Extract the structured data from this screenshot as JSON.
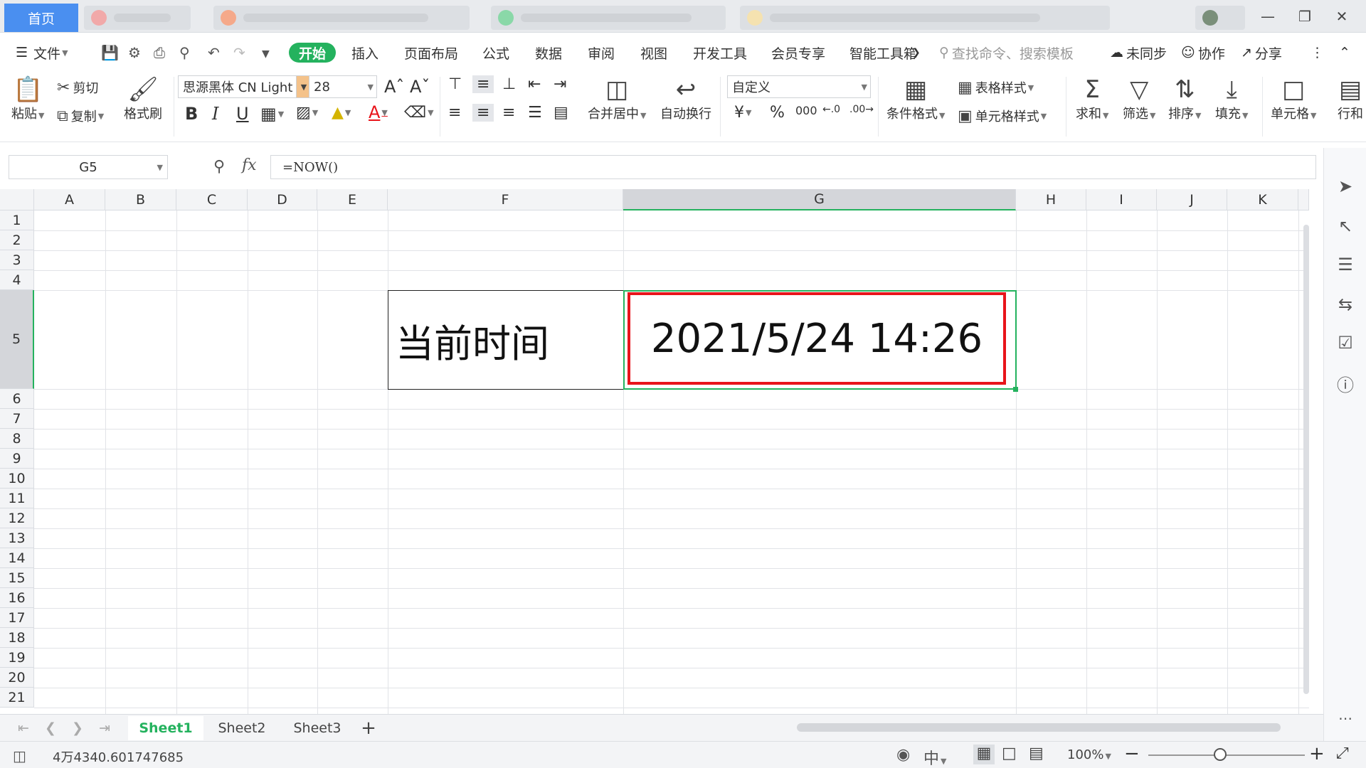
{
  "titlebar": {
    "home_tab": "首页"
  },
  "menu": {
    "file": "文件",
    "tabs": [
      "开始",
      "插入",
      "页面布局",
      "公式",
      "数据",
      "审阅",
      "视图",
      "开发工具",
      "会员专享",
      "智能工具箱"
    ],
    "search_placeholder": "查找命令、搜索模板",
    "unsynced": "未同步",
    "collab": "协作",
    "share": "分享"
  },
  "ribbon": {
    "paste": "粘贴",
    "cut": "剪切",
    "copy": "复制",
    "format_painter": "格式刷",
    "font_name": "思源黑体 CN Light",
    "font_size": "28",
    "merge_center": "合并居中",
    "wrap_text": "自动换行",
    "number_format": "自定义",
    "conditional_format": "条件格式",
    "table_style": "表格样式",
    "cell_style": "单元格样式",
    "sum": "求和",
    "filter": "筛选",
    "sort": "排序",
    "fill": "填充",
    "cell": "单元格",
    "row_col": "行和"
  },
  "formula_bar": {
    "cell_ref": "G5",
    "formula": "=NOW()"
  },
  "sheet": {
    "columns": [
      "A",
      "B",
      "C",
      "D",
      "E",
      "F",
      "G",
      "H",
      "I",
      "J",
      "K"
    ],
    "rows": [
      "1",
      "2",
      "3",
      "4",
      "5",
      "6",
      "7",
      "8",
      "9",
      "10",
      "11",
      "12",
      "13",
      "14",
      "15",
      "16",
      "17",
      "18",
      "19",
      "20",
      "21"
    ],
    "cells": {
      "F5": "当前时间",
      "G5": "2021/5/24 14:26"
    }
  },
  "sheet_tabs": [
    "Sheet1",
    "Sheet2",
    "Sheet3"
  ],
  "status": {
    "sum_value": "4万4340.601747685",
    "zoom": "100%"
  },
  "colors": {
    "accent_green": "#24b25e",
    "home_tab": "#4a8ff0",
    "highlight_red": "#e8141b"
  }
}
